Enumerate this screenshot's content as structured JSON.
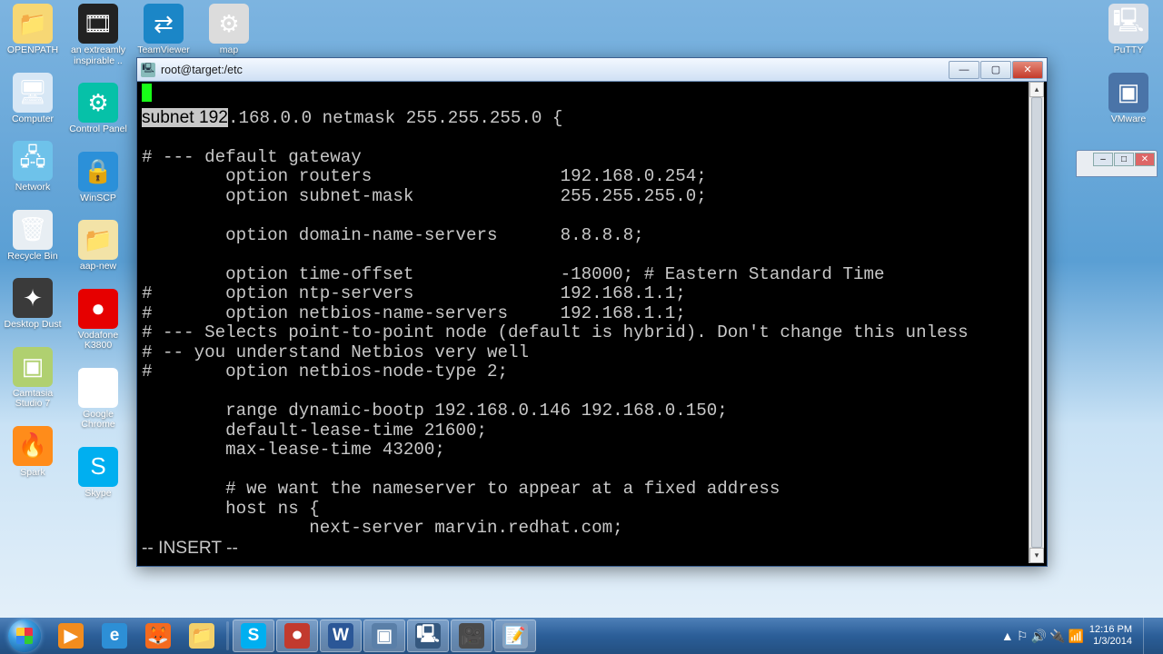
{
  "desktop_icons_col1": [
    {
      "name": "openpath",
      "label": "OPENPATH",
      "glyph": "📁",
      "cls": "g-folder"
    },
    {
      "name": "computer",
      "label": "Computer",
      "glyph": "🖥",
      "cls": "g-pc"
    },
    {
      "name": "network",
      "label": "Network",
      "glyph": "🖧",
      "cls": "g-net"
    },
    {
      "name": "recycle",
      "label": "Recycle Bin",
      "glyph": "🗑",
      "cls": "g-bin"
    },
    {
      "name": "desktopdust",
      "label": "Desktop Dust",
      "glyph": "✦",
      "cls": "g-dust"
    },
    {
      "name": "camtasia",
      "label": "Camtasia Studio 7",
      "glyph": "▣",
      "cls": "g-cam"
    },
    {
      "name": "spark",
      "label": "Spark",
      "glyph": "🔥",
      "cls": "g-spark"
    }
  ],
  "desktop_icons_col2": [
    {
      "name": "extreamly",
      "label": "an extreamly inspirable ..",
      "glyph": "🎞",
      "cls": "g-media"
    },
    {
      "name": "controlpanel",
      "label": "Control Panel",
      "glyph": "⚙",
      "cls": "g-panel"
    },
    {
      "name": "winscp",
      "label": "WinSCP",
      "glyph": "🔒",
      "cls": "g-winscp"
    },
    {
      "name": "aapnew",
      "label": "aap-new",
      "glyph": "📁",
      "cls": "g-fold2"
    },
    {
      "name": "vodafone",
      "label": "Vodafone K3800",
      "glyph": "●",
      "cls": "g-voda"
    },
    {
      "name": "chrome",
      "label": "Google Chrome",
      "glyph": "◎",
      "cls": "g-chrome"
    },
    {
      "name": "skype",
      "label": "Skype",
      "glyph": "S",
      "cls": "g-skype"
    }
  ],
  "desktop_icons_col3": [
    {
      "name": "teamviewer",
      "label": "TeamViewer",
      "glyph": "⇄",
      "cls": "g-tv"
    }
  ],
  "desktop_icons_col4": [
    {
      "name": "map",
      "label": "map",
      "glyph": "⚙",
      "cls": "g-gear"
    }
  ],
  "desktop_icons_right": [
    {
      "name": "putty-desktop",
      "label": "PuTTY",
      "glyph": "🖳",
      "cls": "g-putty"
    },
    {
      "name": "vmware",
      "label": "VMware",
      "glyph": "▣",
      "cls": "g-vm"
    }
  ],
  "putty": {
    "title": "root@target:/etc",
    "selected": "subnet 192",
    "rest_line": ".168.0.0 netmask 255.255.255.0 {",
    "lines": [
      "",
      "# --- default gateway",
      "        option routers                  192.168.0.254;",
      "        option subnet-mask              255.255.255.0;",
      "",
      "        option domain-name-servers      8.8.8.8;",
      "",
      "        option time-offset              -18000; # Eastern Standard Time",
      "#       option ntp-servers              192.168.1.1;",
      "#       option netbios-name-servers     192.168.1.1;",
      "# --- Selects point-to-point node (default is hybrid). Don't change this unless",
      "# -- you understand Netbios very well",
      "#       option netbios-node-type 2;",
      "",
      "        range dynamic-bootp 192.168.0.146 192.168.0.150;",
      "        default-lease-time 21600;",
      "        max-lease-time 43200;",
      "",
      "        # we want the nameserver to appear at a fixed address",
      "        host ns {",
      "                next-server marvin.redhat.com;"
    ],
    "mode": "-- INSERT --"
  },
  "taskbar": {
    "pins": [
      {
        "name": "mediaplayer",
        "glyph": "▶",
        "color": "#f28c1e",
        "active": false
      },
      {
        "name": "ie",
        "glyph": "e",
        "color": "#2d8fd6",
        "active": false
      },
      {
        "name": "firefox",
        "glyph": "🦊",
        "color": "#f36a1e",
        "active": false
      },
      {
        "name": "explorer",
        "glyph": "📁",
        "color": "#f3d06a",
        "active": false
      },
      {
        "name": "skype",
        "glyph": "S",
        "color": "#00aff0",
        "active": true
      },
      {
        "name": "screenrec",
        "glyph": "⏺",
        "color": "#c23a2e",
        "active": true
      },
      {
        "name": "word",
        "glyph": "W",
        "color": "#2b5797",
        "active": true
      },
      {
        "name": "vmware-task",
        "glyph": "▣",
        "color": "#5a7fa8",
        "active": true
      },
      {
        "name": "putty-task",
        "glyph": "🖳",
        "color": "#35587f",
        "active": true
      },
      {
        "name": "camtasia-task",
        "glyph": "🎥",
        "color": "#4a4a4a",
        "active": true
      },
      {
        "name": "notes",
        "glyph": "📝",
        "color": "#8aa4c0",
        "active": true
      }
    ],
    "tray_icons": [
      "▲",
      "⚐",
      "🔊",
      "🔌",
      "📶"
    ],
    "time": "12:16 PM",
    "date": "1/3/2014"
  }
}
